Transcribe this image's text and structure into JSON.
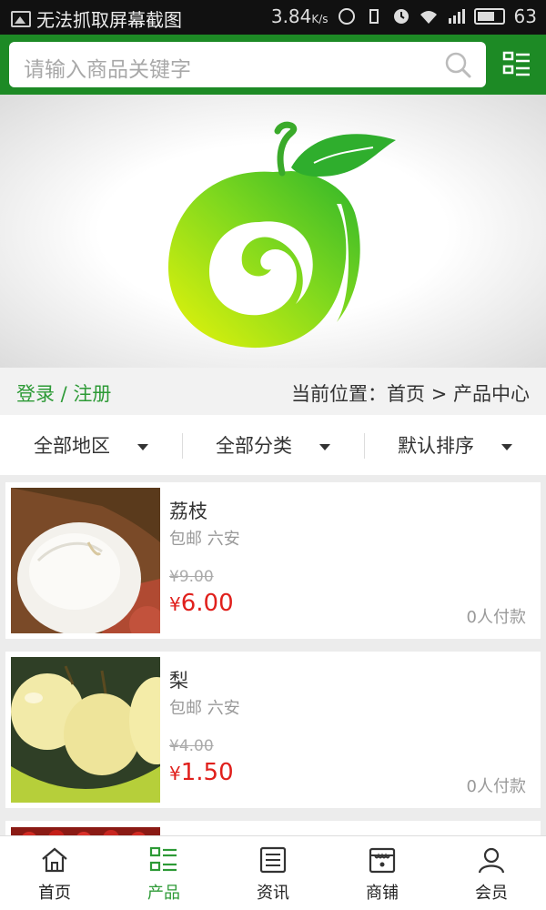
{
  "status_bar": {
    "left_text": "无法抓取屏幕截图",
    "speed": "3.84",
    "speed_unit": "K/s",
    "battery": "63"
  },
  "search": {
    "placeholder": "请输入商品关键字"
  },
  "header_icons": {
    "search": "search-icon",
    "menu": "category-menu-icon"
  },
  "account": {
    "login_register": "登录 / 注册"
  },
  "breadcrumb": {
    "text": "当前位置：首页 > 产品中心"
  },
  "filters": [
    {
      "label": "全部地区"
    },
    {
      "label": "全部分类"
    },
    {
      "label": "默认排序"
    }
  ],
  "products": [
    {
      "name": "荔枝",
      "meta": "包邮 六安",
      "old_price": "¥9.00",
      "currency": "¥",
      "price": "6.00",
      "paid": "0人付款",
      "image": "lychee"
    },
    {
      "name": "梨",
      "meta": "包邮 六安",
      "old_price": "¥4.00",
      "currency": "¥",
      "price": "1.50",
      "paid": "0人付款",
      "image": "pear"
    }
  ],
  "tabs": [
    {
      "label": "首页",
      "icon": "home-icon",
      "active": false
    },
    {
      "label": "产品",
      "icon": "product-grid-icon",
      "active": true
    },
    {
      "label": "资讯",
      "icon": "news-icon",
      "active": false
    },
    {
      "label": "商铺",
      "icon": "shop-icon",
      "active": false
    },
    {
      "label": "会员",
      "icon": "member-icon",
      "active": false
    }
  ],
  "colors": {
    "brand_green": "#1d8a25",
    "accent_green": "#2d9a36",
    "price_red": "#e0201c"
  }
}
